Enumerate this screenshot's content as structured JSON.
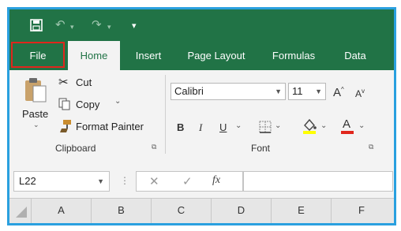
{
  "colors": {
    "accent": "#217346",
    "frame": "#2aa0df",
    "highlight": "#e0261c",
    "ribbon_bg": "#f3f3f3"
  },
  "quick_access": {
    "icons": [
      "save-icon",
      "undo-icon",
      "redo-icon",
      "customize-qat-icon"
    ]
  },
  "tabs": [
    {
      "label": "File"
    },
    {
      "label": "Home"
    },
    {
      "label": "Insert"
    },
    {
      "label": "Page Layout"
    },
    {
      "label": "Formulas"
    },
    {
      "label": "Data"
    }
  ],
  "clipboard": {
    "paste_label": "Paste",
    "cut_label": "Cut",
    "copy_label": "Copy",
    "format_painter_label": "Format Painter",
    "group_label": "Clipboard"
  },
  "font": {
    "name_value": "Calibri",
    "size_value": "11",
    "bold": "B",
    "italic": "I",
    "underline": "U",
    "increase": "A",
    "decrease": "A",
    "font_color_letter": "A",
    "group_label": "Font"
  },
  "formula_bar": {
    "name_box_value": "L22",
    "fx_label": "fx"
  },
  "columns": [
    "A",
    "B",
    "C",
    "D",
    "E",
    "F"
  ]
}
